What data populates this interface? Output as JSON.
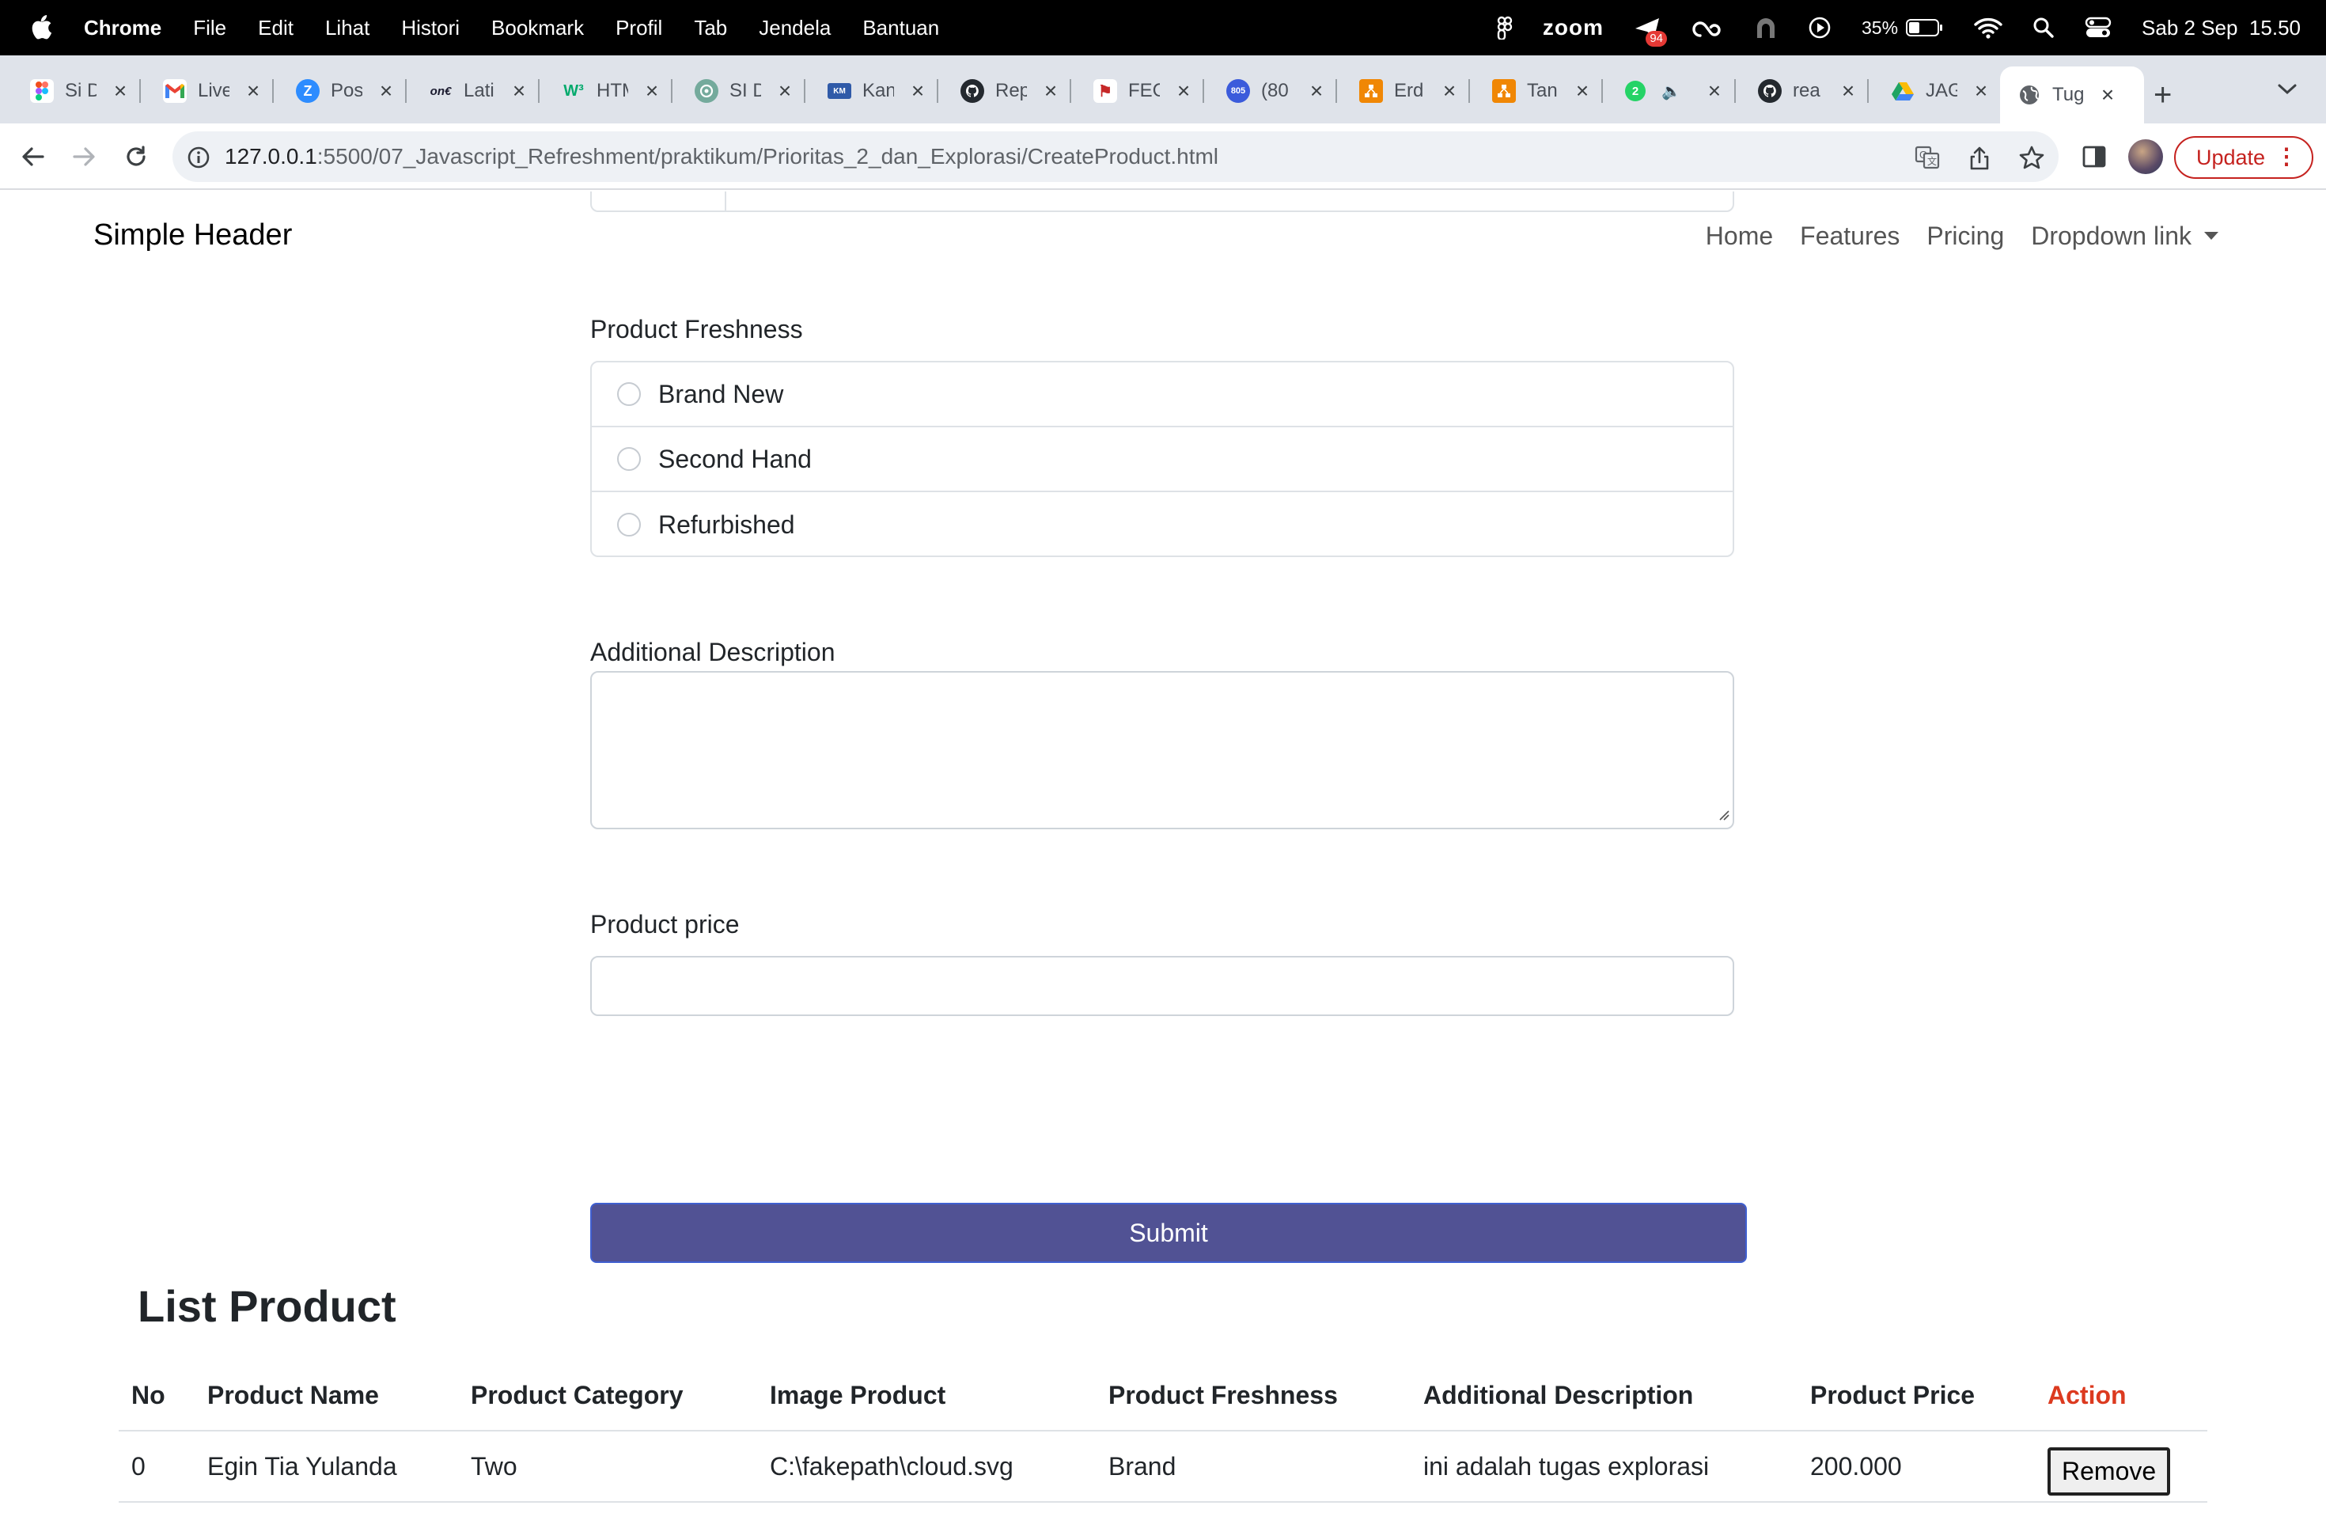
{
  "menubar": {
    "app_name": "Chrome",
    "items": [
      "File",
      "Edit",
      "Lihat",
      "Histori",
      "Bookmark",
      "Profil",
      "Tab",
      "Jendela",
      "Bantuan"
    ],
    "zoom_label": "zoom",
    "notification_badge": "94",
    "battery_percent": "35%",
    "datetime": "Sab 2 Sep  15.50"
  },
  "tabs": [
    {
      "title": "Si D",
      "icon": "figma-icon",
      "color": "#f24e1e"
    },
    {
      "title": "Live",
      "icon": "gmail-icon",
      "color": "#ea4335"
    },
    {
      "title": "Pos",
      "icon": "zoom-app-icon",
      "color": "#2d8cff"
    },
    {
      "title": "Lati",
      "icon": "one-icon",
      "color": "#1a1a2e"
    },
    {
      "title": "HTM",
      "icon": "w3-icon",
      "color": "#04aa6d"
    },
    {
      "title": "SI D",
      "icon": "openai-icon",
      "color": "#74aa9c"
    },
    {
      "title": "Kan",
      "icon": "kampus-merdeka-icon",
      "color": "#2f5aa8"
    },
    {
      "title": "Rep",
      "icon": "github-icon",
      "color": "#24292f"
    },
    {
      "title": "FEC",
      "icon": "alterra-icon",
      "color": "#c62828"
    },
    {
      "title": "(80",
      "icon": "mail-badge-icon",
      "color": "#3b5bdb"
    },
    {
      "title": "Erd",
      "icon": "drawio-icon",
      "color": "#f08705"
    },
    {
      "title": "Tan",
      "icon": "drawio-icon",
      "color": "#f08705"
    },
    {
      "title": "",
      "icon": "whatsapp-icon",
      "color": "#25d366"
    },
    {
      "title": "rea",
      "icon": "github-icon",
      "color": "#24292f"
    },
    {
      "title": "JAG",
      "icon": "google-drive-icon",
      "color": "#1fa463"
    },
    {
      "title": "Tug",
      "icon": "globe-icon",
      "color": "#5f6368",
      "active": true
    }
  ],
  "toolbar": {
    "url_host": "127.0.0.1",
    "url_path": ":5500/07_Javascript_Refreshment/praktikum/Prioritas_2_dan_Explorasi/CreateProduct.html",
    "update_label": "Update"
  },
  "site": {
    "brand": "Simple Header",
    "nav": [
      "Home",
      "Features",
      "Pricing",
      "Dropdown link"
    ]
  },
  "form": {
    "freshness_label": "Product Freshness",
    "freshness_options": [
      "Brand New",
      "Second Hand",
      "Refurbished"
    ],
    "description_label": "Additional Description",
    "description_value": "",
    "price_label": "Product price",
    "price_value": "",
    "submit_label": "Submit"
  },
  "list": {
    "title": "List Product",
    "columns": [
      "No",
      "Product Name",
      "Product Category",
      "Image Product",
      "Product Freshness",
      "Additional Description",
      "Product Price",
      "Action"
    ],
    "rows": [
      {
        "no": "0",
        "name": "Egin Tia Yulanda",
        "category": "Two",
        "image": "C:\\fakepath\\cloud.svg",
        "freshness": "Brand",
        "description": "ini adalah tugas explorasi",
        "price": "200.000",
        "action": "Remove"
      }
    ]
  },
  "colors": {
    "submit_bg": "#515294",
    "action_header": "#dc3a1f",
    "update_accent": "#c5221f"
  }
}
